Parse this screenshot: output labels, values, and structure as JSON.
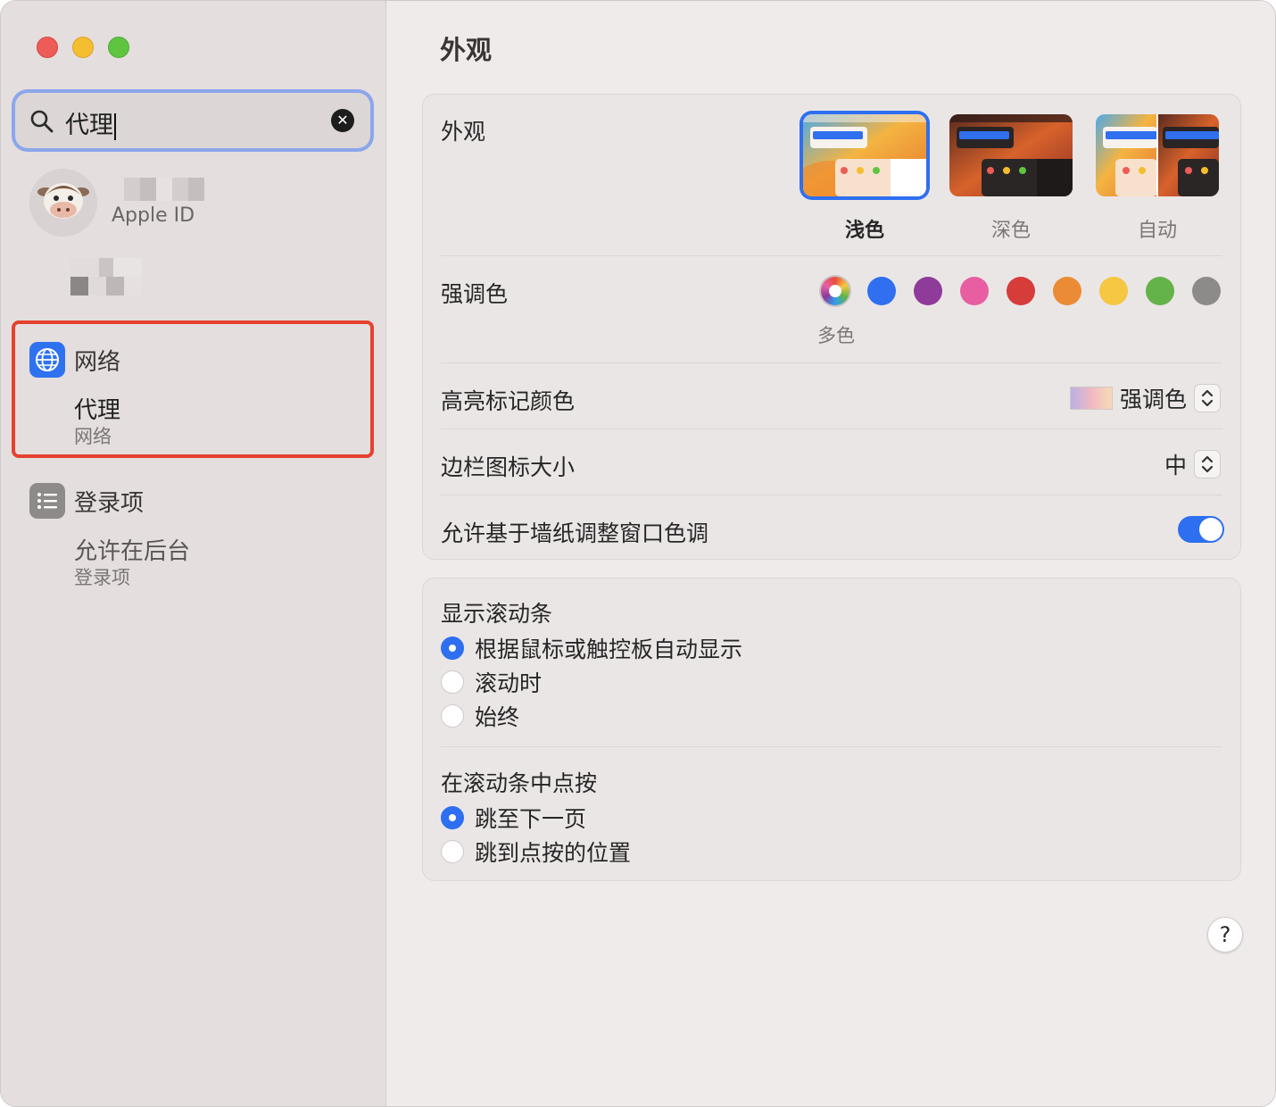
{
  "sidebar": {
    "search": {
      "value": "代理"
    },
    "account": {
      "label": "Apple ID"
    },
    "results": [
      {
        "title": "网络",
        "match": "代理",
        "section": "网络"
      },
      {
        "title": "登录项",
        "match": "允许在后台",
        "section": "登录项"
      }
    ]
  },
  "main": {
    "title": "外观",
    "appearance": {
      "label": "外观",
      "options": [
        "浅色",
        "深色",
        "自动"
      ],
      "selected": "浅色"
    },
    "accent": {
      "label": "强调色",
      "selected_name": "多色",
      "colors": [
        "multicolor",
        "#2f6ff0",
        "#8e3b9a",
        "#e75fa2",
        "#d63c3a",
        "#eb8b35",
        "#f5c742",
        "#63b34a",
        "#8d8a8a"
      ]
    },
    "highlight": {
      "label": "高亮标记颜色",
      "value": "强调色"
    },
    "sidebar_icon_size": {
      "label": "边栏图标大小",
      "value": "中"
    },
    "wallpaper_tint": {
      "label": "允许基于墙纸调整窗口色调",
      "on": true
    },
    "show_scrollbars": {
      "label": "显示滚动条",
      "options": [
        "根据鼠标或触控板自动显示",
        "滚动时",
        "始终"
      ],
      "selected_index": 0
    },
    "click_scrollbar": {
      "label": "在滚动条中点按",
      "options": [
        "跳至下一页",
        "跳到点按的位置"
      ],
      "selected_index": 0
    },
    "help": "?"
  }
}
